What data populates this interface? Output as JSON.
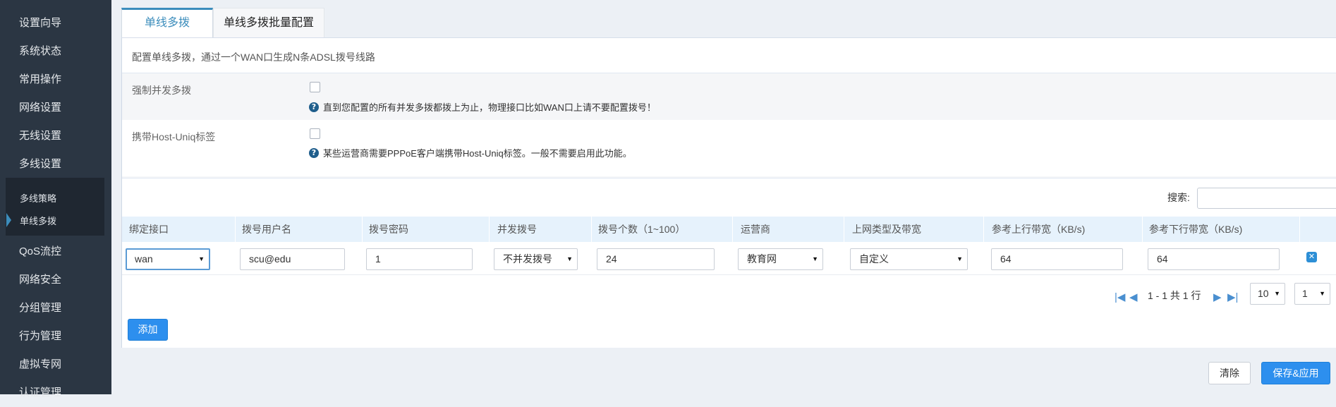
{
  "sidebar": {
    "items": [
      {
        "label": "设置向导"
      },
      {
        "label": "系统状态"
      },
      {
        "label": "常用操作"
      },
      {
        "label": "网络设置"
      },
      {
        "label": "无线设置"
      },
      {
        "label": "多线设置"
      },
      {
        "label": "QoS流控"
      },
      {
        "label": "网络安全"
      },
      {
        "label": "分组管理"
      },
      {
        "label": "行为管理"
      },
      {
        "label": "虚拟专网"
      },
      {
        "label": "认证管理"
      }
    ],
    "subitems": [
      {
        "label": "多线策略"
      },
      {
        "label": "单线多拨",
        "active": true
      }
    ]
  },
  "tabs": [
    {
      "label": "单线多拨",
      "active": true
    },
    {
      "label": "单线多拨批量配置",
      "active": false
    }
  ],
  "description": "配置单线多拨，通过一个WAN口生成N条ADSL拨号线路",
  "options": [
    {
      "label": "强制并发多拨",
      "checked": false,
      "help": "直到您配置的所有并发多拨都拨上为止，物理接口比如WAN口上请不要配置拨号！"
    },
    {
      "label": "携带Host-Uniq标签",
      "checked": false,
      "help": "某些运营商需要PPPoE客户端携带Host-Uniq标签。一般不需要启用此功能。"
    }
  ],
  "search": {
    "label": "搜索:",
    "value": ""
  },
  "table": {
    "columns": [
      "绑定接口",
      "拨号用户名",
      "拨号密码",
      "并发拨号",
      "拨号个数（1~100）",
      "运营商",
      "上网类型及带宽",
      "参考上行带宽（KB/s)",
      "参考下行带宽（KB/s)"
    ],
    "rows": [
      {
        "interface": "wan",
        "username": "scu@edu",
        "password": "1",
        "concurrent": "不并发拨号",
        "count": "24",
        "isp": "教育网",
        "type": "自定义",
        "up": "64",
        "down": "64"
      }
    ]
  },
  "pager": {
    "info": "1 - 1 共 1 行",
    "page_size": "10",
    "page": "1"
  },
  "buttons": {
    "add": "添加",
    "clear": "清除",
    "save": "保存&应用"
  },
  "colors": {
    "sidebar_bg": "#2b3643",
    "accent": "#3c8dbc",
    "primary_button": "#2d8fee",
    "table_header": "#e6f2fc"
  }
}
